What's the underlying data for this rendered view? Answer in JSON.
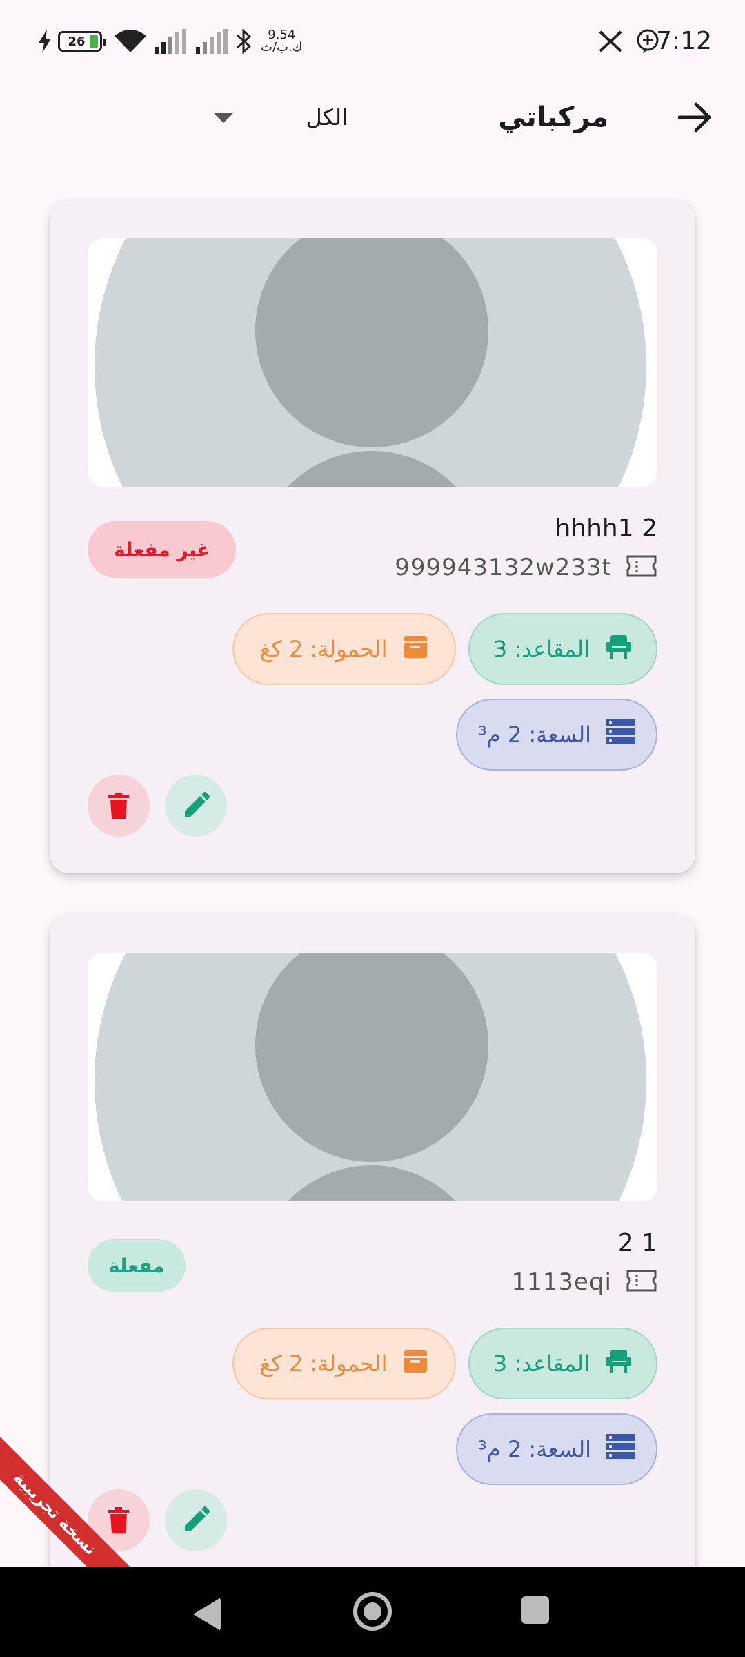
{
  "status_bar": {
    "battery": "26",
    "net_speed_value": "9.54",
    "net_speed_unit": "ك.ب/ث",
    "time": "7:12",
    "icons": [
      "charging-icon",
      "battery-icon",
      "wifi-icon",
      "signal-icon",
      "signal-icon",
      "bluetooth-icon",
      "x-icon",
      "app-icon"
    ]
  },
  "app_bar": {
    "title": "مركباتي",
    "filter_value": "الكل"
  },
  "vehicles": [
    {
      "name": "hhhh1 2",
      "plate": "999943132w233t",
      "status": "غير مفعلة",
      "seats": "المقاعد: 3",
      "load": "الحمولة: 2 كغ",
      "capacity": "السعة: 2 م³"
    },
    {
      "name": "2 1",
      "plate": "1113eqi",
      "status": "مفعلة",
      "seats": "المقاعد: 3",
      "load": "الحمولة: 2 كغ",
      "capacity": "السعة: 2 م³"
    }
  ],
  "ribbon": "نسخة تجريبية",
  "colors": {
    "background": "#fdf7fb",
    "card": "#f6eff5",
    "inactive": "#e01a2a",
    "active": "#19a37f",
    "load": "#ef8a3a",
    "capacity": "#3d57a7"
  }
}
